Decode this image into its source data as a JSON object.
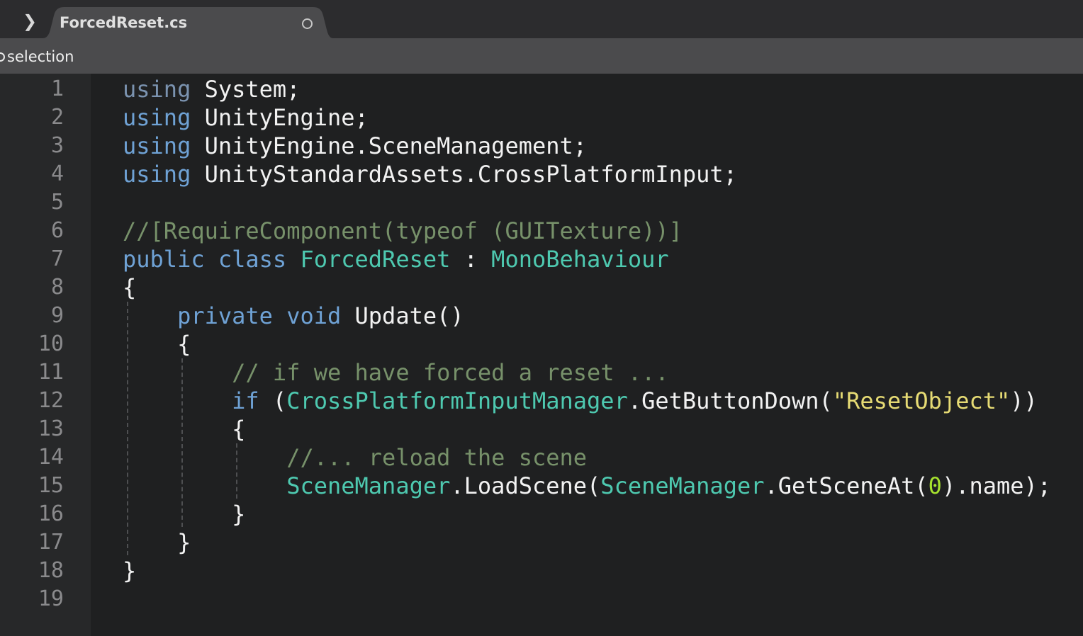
{
  "tab": {
    "title": "ForcedReset.cs",
    "toggle_icon": "chevron-right-icon",
    "dirty_icon": "unsaved-dot-icon"
  },
  "infobar": {
    "text": "selection"
  },
  "editor": {
    "line_numbers": [
      "1",
      "2",
      "3",
      "4",
      "5",
      "6",
      "7",
      "8",
      "9",
      "10",
      "11",
      "12",
      "13",
      "14",
      "15",
      "16",
      "17",
      "18",
      "19"
    ],
    "lines": [
      [
        [
          "kwd",
          "using"
        ],
        [
          "pl",
          " System;"
        ]
      ],
      [
        [
          "kw",
          "using"
        ],
        [
          "pl",
          " UnityEngine;"
        ]
      ],
      [
        [
          "kw",
          "using"
        ],
        [
          "pl",
          " UnityEngine.SceneManagement;"
        ]
      ],
      [
        [
          "kw",
          "using"
        ],
        [
          "pl",
          " UnityStandardAssets.CrossPlatformInput;"
        ]
      ],
      [],
      [
        [
          "cm",
          "//[RequireComponent(typeof (GUITexture))]"
        ]
      ],
      [
        [
          "kw",
          "public"
        ],
        [
          "pl",
          " "
        ],
        [
          "kw",
          "class"
        ],
        [
          "pl",
          " "
        ],
        [
          "ty",
          "ForcedReset"
        ],
        [
          "pl",
          " : "
        ],
        [
          "ty",
          "MonoBehaviour"
        ]
      ],
      [
        [
          "pl",
          "{"
        ]
      ],
      [
        [
          "pl",
          "    "
        ],
        [
          "kw",
          "private"
        ],
        [
          "pl",
          " "
        ],
        [
          "kw",
          "void"
        ],
        [
          "pl",
          " Update()"
        ]
      ],
      [
        [
          "pl",
          "    {"
        ]
      ],
      [
        [
          "pl",
          "        "
        ],
        [
          "cm",
          "// if we have forced a reset ..."
        ]
      ],
      [
        [
          "pl",
          "        "
        ],
        [
          "kw",
          "if"
        ],
        [
          "pl",
          " ("
        ],
        [
          "ty",
          "CrossPlatformInputManager"
        ],
        [
          "pl",
          ".GetButtonDown("
        ],
        [
          "st",
          "\"ResetObject\""
        ],
        [
          "pl",
          "))"
        ]
      ],
      [
        [
          "pl",
          "        {"
        ]
      ],
      [
        [
          "pl",
          "            "
        ],
        [
          "cm",
          "//... reload the scene"
        ]
      ],
      [
        [
          "pl",
          "            "
        ],
        [
          "ty",
          "SceneManager"
        ],
        [
          "pl",
          ".LoadScene("
        ],
        [
          "ty",
          "SceneManager"
        ],
        [
          "pl",
          ".GetSceneAt("
        ],
        [
          "nu",
          "0"
        ],
        [
          "pl",
          ").name);"
        ]
      ],
      [
        [
          "pl",
          "        }"
        ]
      ],
      [
        [
          "pl",
          "    }"
        ]
      ],
      [
        [
          "pl",
          "}"
        ]
      ],
      []
    ]
  },
  "colors": {
    "keyword": "#6fa2d5",
    "type": "#4ec9b0",
    "string": "#e6db74",
    "number": "#a6e22e",
    "comment": "#77916a",
    "plain": "#f2f2f2",
    "background": "#1f2021",
    "gutter": "#272829"
  }
}
